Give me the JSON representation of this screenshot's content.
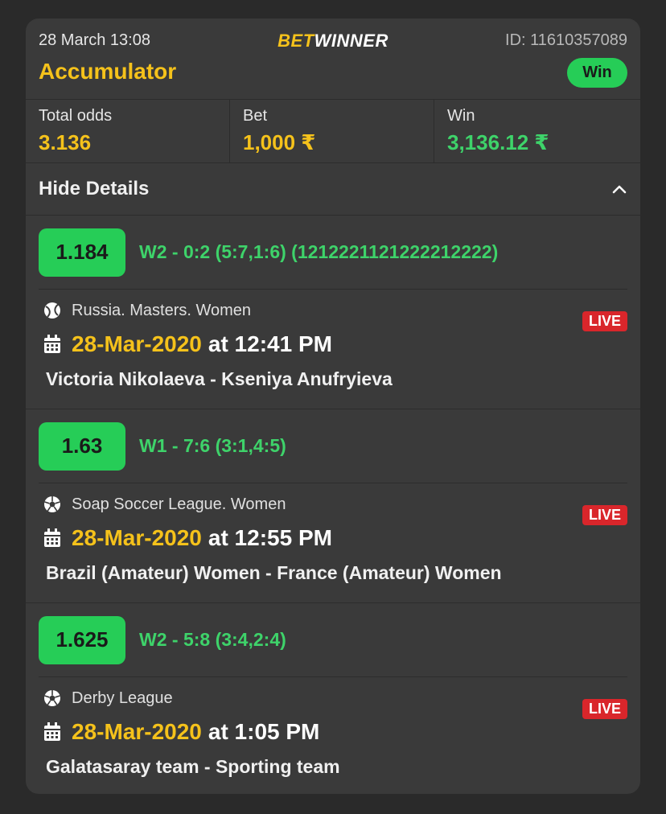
{
  "header": {
    "date": "28 March 13:08",
    "logo_bet": "BET",
    "logo_winner": "WINNER",
    "id_text": "ID: 11610357089",
    "bet_type": "Accumulator",
    "status": "Win"
  },
  "summary": {
    "total_odds_label": "Total odds",
    "total_odds_value": "3.136",
    "bet_label": "Bet",
    "bet_value": "1,000 ₹",
    "win_label": "Win",
    "win_value": "3,136.12 ₹"
  },
  "details": {
    "label": "Hide Details"
  },
  "events": [
    {
      "odds": "1.184",
      "outcome": "W2 - 0:2 (5:7,1:6) (1212221121222212222)",
      "sport_icon": "tennis-ball-icon",
      "league": "Russia. Masters. Women",
      "live": "LIVE",
      "date": "28-Mar-2020",
      "time": "at 12:41 PM",
      "teams": "Victoria Nikolaeva - Kseniya Anufryieva"
    },
    {
      "odds": "1.63",
      "outcome": "W1 - 7:6 (3:1,4:5)",
      "sport_icon": "soccer-ball-icon",
      "league": "Soap Soccer League. Women",
      "live": "LIVE",
      "date": "28-Mar-2020",
      "time": "at 12:55 PM",
      "teams": "Brazil (Amateur) Women - France (Amateur) Women"
    },
    {
      "odds": "1.625",
      "outcome": "W2 - 5:8 (3:4,2:4)",
      "sport_icon": "soccer-ball-icon",
      "league": "Derby League",
      "live": "LIVE",
      "date": "28-Mar-2020",
      "time": "at 1:05 PM",
      "teams": "Galatasaray team - Sporting team"
    }
  ],
  "colors": {
    "accent_yellow": "#f5c21b",
    "win_green": "#26cd57",
    "live_red": "#d9262b",
    "card_bg": "#3a3a3a"
  }
}
